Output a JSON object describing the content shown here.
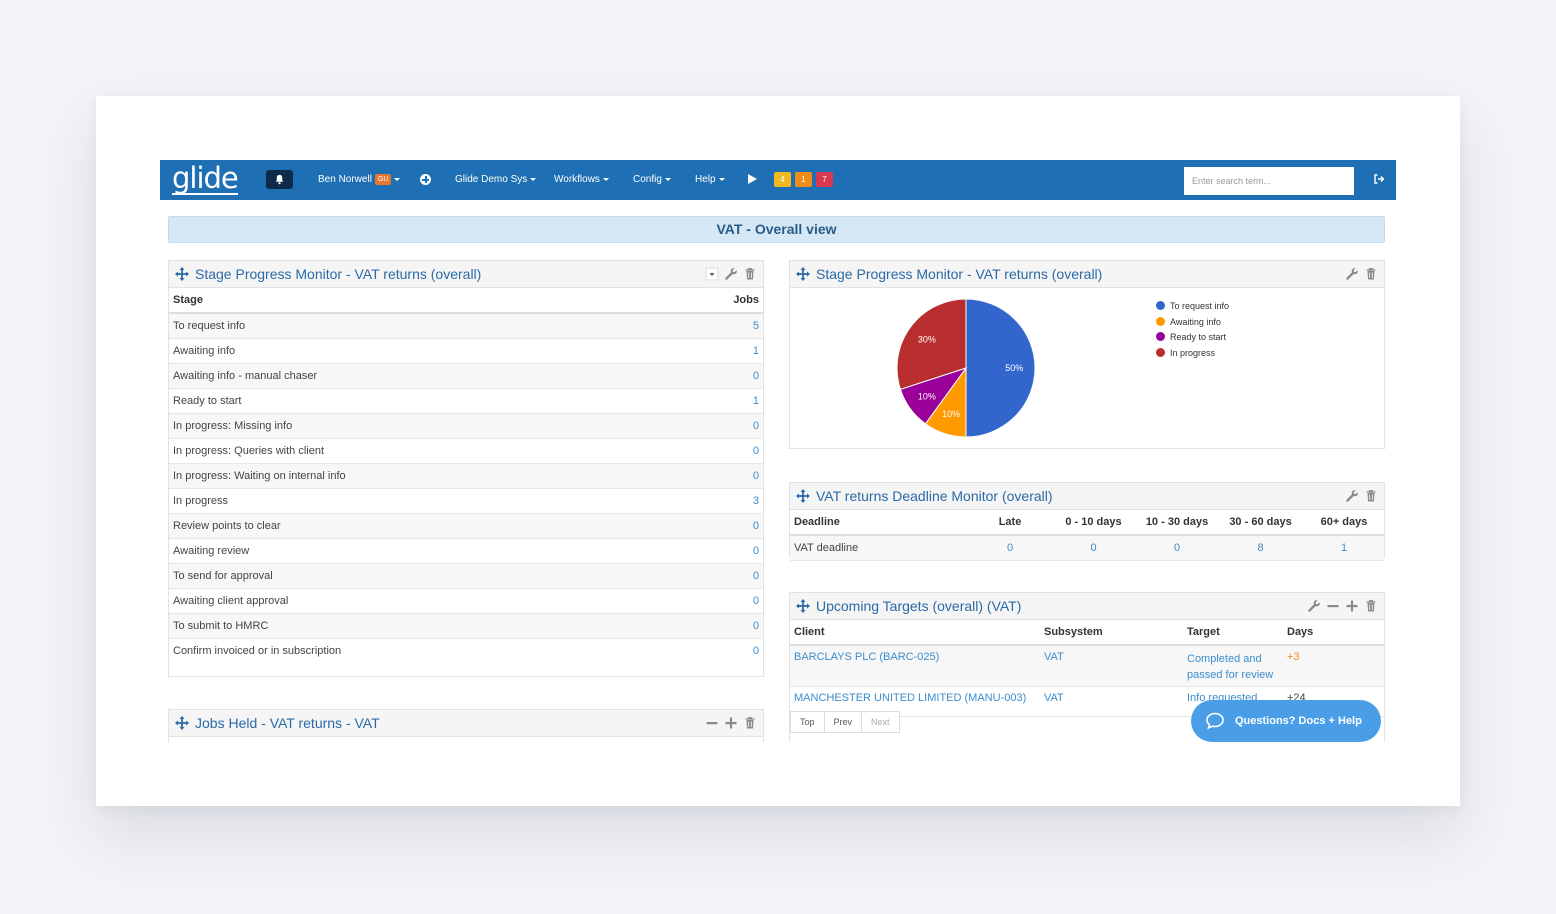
{
  "navbar": {
    "logo": "glide",
    "user_name": "Ben Norwell",
    "user_badge": "GU",
    "system": "Glide Demo Sys",
    "workflows": "Workflows",
    "config": "Config",
    "help": "Help",
    "badges": [
      {
        "label": "4",
        "color": "#f2b81f"
      },
      {
        "label": "1",
        "color": "#f08c1a"
      },
      {
        "label": "7",
        "color": "#d9394e"
      }
    ],
    "search_placeholder": "Enter search term..."
  },
  "page_title": "VAT - Overall view",
  "stage_monitor": {
    "title": "Stage Progress Monitor - VAT returns (overall)",
    "columns": [
      "Stage",
      "Jobs"
    ],
    "rows": [
      {
        "stage": "To request info",
        "jobs": "5"
      },
      {
        "stage": "Awaiting info",
        "jobs": "1"
      },
      {
        "stage": "Awaiting info - manual chaser",
        "jobs": "0"
      },
      {
        "stage": "Ready to start",
        "jobs": "1"
      },
      {
        "stage": "In progress: Missing info",
        "jobs": "0"
      },
      {
        "stage": "In progress: Queries with client",
        "jobs": "0"
      },
      {
        "stage": "In progress: Waiting on internal info",
        "jobs": "0"
      },
      {
        "stage": "In progress",
        "jobs": "3"
      },
      {
        "stage": "Review points to clear",
        "jobs": "0"
      },
      {
        "stage": "Awaiting review",
        "jobs": "0"
      },
      {
        "stage": "To send for approval",
        "jobs": "0"
      },
      {
        "stage": "Awaiting client approval",
        "jobs": "0"
      },
      {
        "stage": "To submit to HMRC",
        "jobs": "0"
      },
      {
        "stage": "Confirm invoiced or in subscription",
        "jobs": "0"
      }
    ]
  },
  "jobs_held": {
    "title": "Jobs Held - VAT returns - VAT"
  },
  "stage_chart": {
    "title": "Stage Progress Monitor - VAT returns (overall)"
  },
  "chart_data": {
    "type": "pie",
    "categories": [
      "To request info",
      "Awaiting info",
      "Ready to start",
      "In progress"
    ],
    "values": [
      50,
      10,
      10,
      30
    ],
    "labels": [
      "50%",
      "10%",
      "10%",
      "30%"
    ],
    "colors": [
      "#3366cc",
      "#ff9900",
      "#990099",
      "#b82e2e"
    ],
    "legend_position": "right"
  },
  "deadline_monitor": {
    "title": "VAT returns Deadline Monitor (overall)",
    "columns": [
      "Deadline",
      "Late",
      "0 - 10 days",
      "10 - 30 days",
      "30 - 60 days",
      "60+ days"
    ],
    "rows": [
      {
        "deadline": "VAT deadline",
        "late": "0",
        "d0_10": "0",
        "d10_30": "0",
        "d30_60": "8",
        "d60": "1"
      }
    ]
  },
  "upcoming_targets": {
    "title": "Upcoming Targets (overall) (VAT)",
    "columns": [
      "Client",
      "Subsystem",
      "Target",
      "Days"
    ],
    "rows": [
      {
        "client": "BARCLAYS PLC (BARC-025)",
        "subsystem": "VAT",
        "target": "Completed and passed for review",
        "days": "+3"
      },
      {
        "client": "MANCHESTER UNITED LIMITED (MANU-003)",
        "subsystem": "VAT",
        "target": "Info requested",
        "days": "+24"
      }
    ],
    "pager": [
      "Top",
      "Prev",
      "Next"
    ]
  },
  "help_button": "Questions? Docs + Help"
}
